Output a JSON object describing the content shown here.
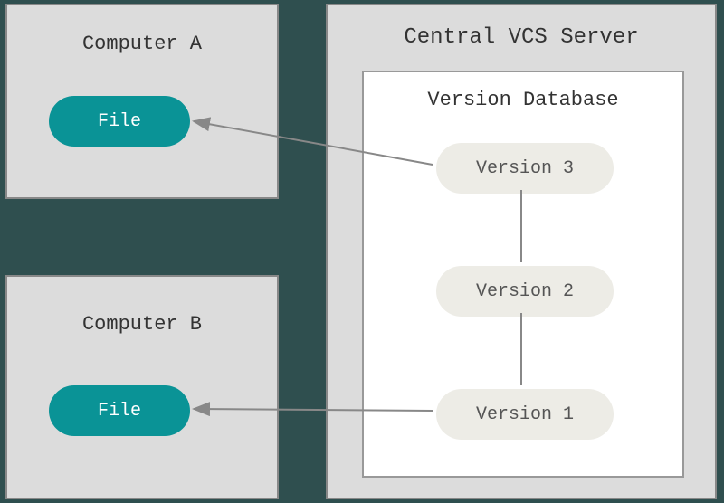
{
  "computerA": {
    "title": "Computer A",
    "file_label": "File"
  },
  "computerB": {
    "title": "Computer B",
    "file_label": "File"
  },
  "server": {
    "title": "Central VCS Server",
    "database": {
      "title": "Version Database",
      "versions": [
        "Version 3",
        "Version 2",
        "Version 1"
      ]
    }
  }
}
